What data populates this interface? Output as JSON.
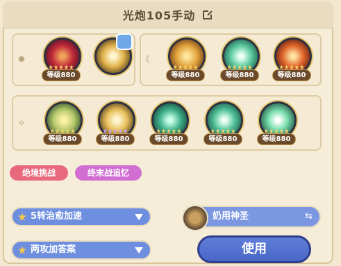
{
  "header": {
    "title": "光炮105手动"
  },
  "loadout": {
    "row1_left": [
      {
        "level": "等级880",
        "icon": "red-flame-skill-icon",
        "stars": 5
      },
      {
        "level": "",
        "icon": "gold-swirl-skill-icon",
        "stars": 0,
        "badge": "blue-sword-badge"
      }
    ],
    "row1_right": [
      {
        "level": "等级880",
        "icon": "gold-crescent-skill-icon",
        "stars": 5
      },
      {
        "level": "等级880",
        "icon": "teal-heal-skill-icon",
        "stars": 5
      },
      {
        "level": "等级880",
        "icon": "orange-flare-skill-icon",
        "stars": 5
      }
    ],
    "row2": [
      {
        "level": "等级880",
        "icon": "green-gold-swirl-skill-icon",
        "stars": 5
      },
      {
        "level": "等级880",
        "icon": "gold-spiral-skill-icon",
        "stars": 5,
        "star_color": "purple"
      },
      {
        "level": "等级880",
        "icon": "teal-cross-skill-icon",
        "stars": 5
      },
      {
        "level": "等级880",
        "icon": "teal-heal-burst-skill-icon",
        "stars": 5
      },
      {
        "level": "等级880",
        "icon": "green-star-burst-skill-icon",
        "stars": 5
      }
    ]
  },
  "tags": [
    {
      "label": "绝境挑战",
      "color": "#e9697c"
    },
    {
      "label": "终末战追忆",
      "color": "#d06ed2"
    }
  ],
  "dropdowns": {
    "first": {
      "label": "5转治愈加速"
    },
    "second": {
      "label": "两攻加答案"
    }
  },
  "swap": {
    "label": "奶用神圣"
  },
  "use_button": {
    "label": "使用"
  },
  "colors": {
    "accent": "#6e8fe0",
    "background": "#f3e8cf"
  }
}
